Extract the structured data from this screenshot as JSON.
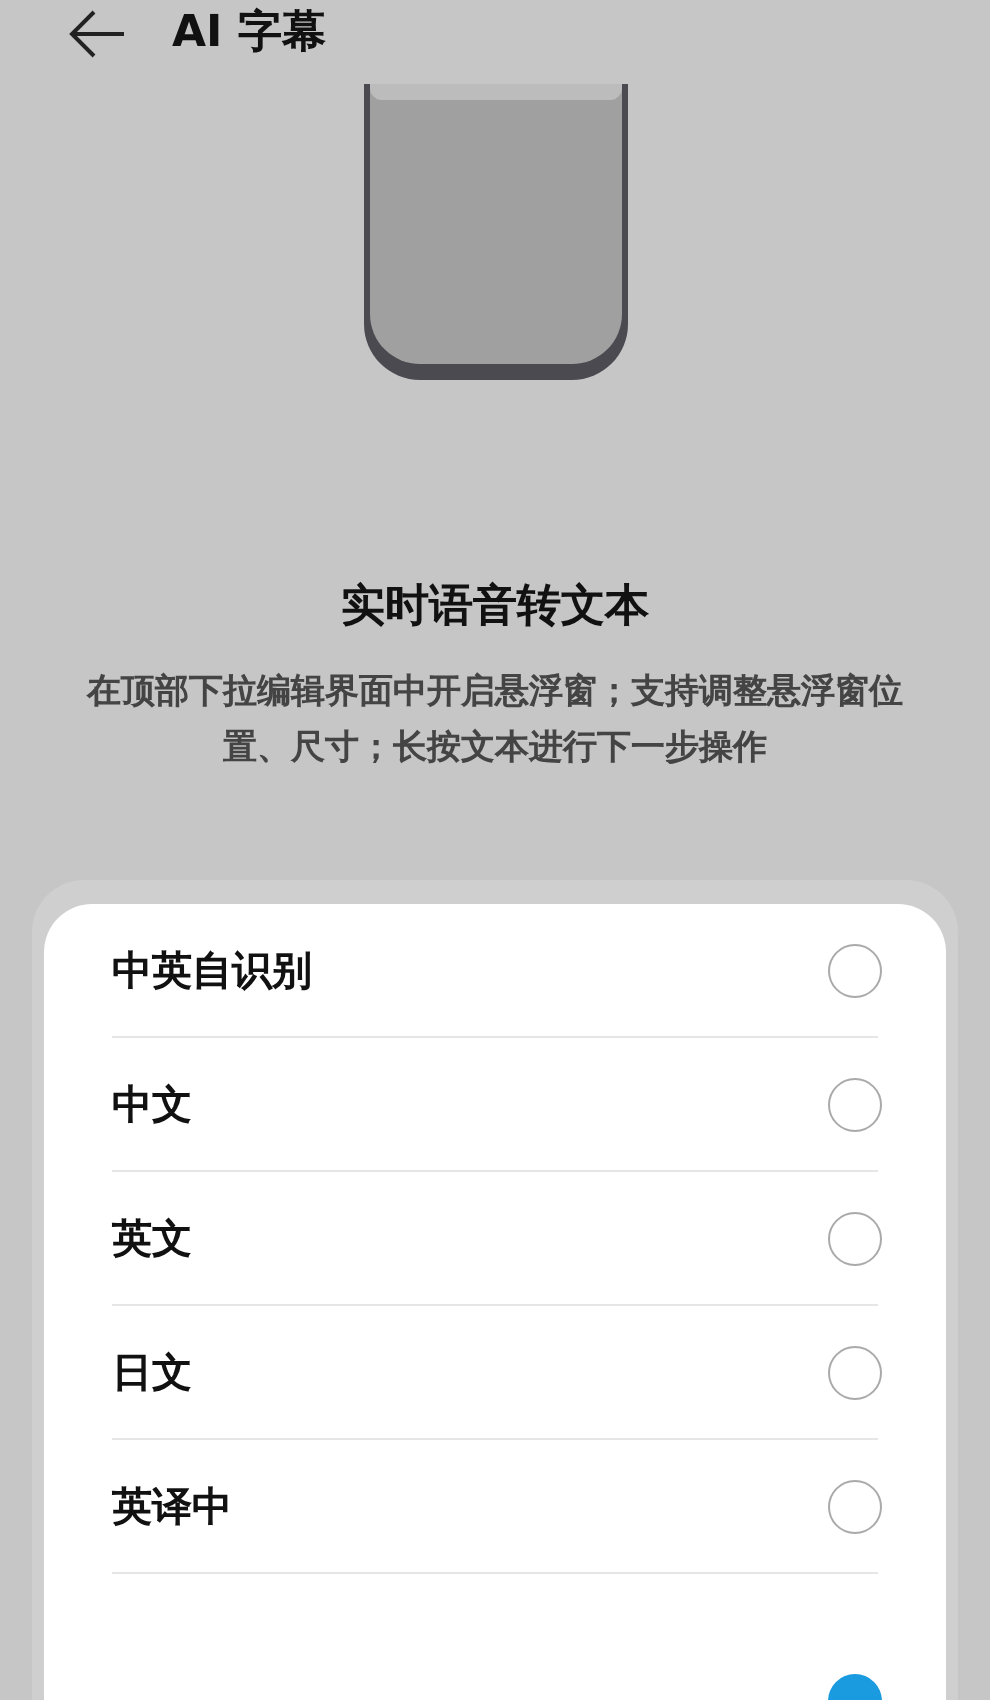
{
  "header": {
    "title": "AI 字幕"
  },
  "intro": {
    "title": "实时语音转文本",
    "description": "在顶部下拉编辑界面中开启悬浮窗；支持调整悬浮窗位置、尺寸；长按文本进行下一步操作"
  },
  "options": [
    {
      "label": "中英自识别",
      "selected": false
    },
    {
      "label": "中文",
      "selected": false
    },
    {
      "label": "英文",
      "selected": false
    },
    {
      "label": "日文",
      "selected": false
    },
    {
      "label": "英译中",
      "selected": false
    },
    {
      "selected": true
    }
  ]
}
